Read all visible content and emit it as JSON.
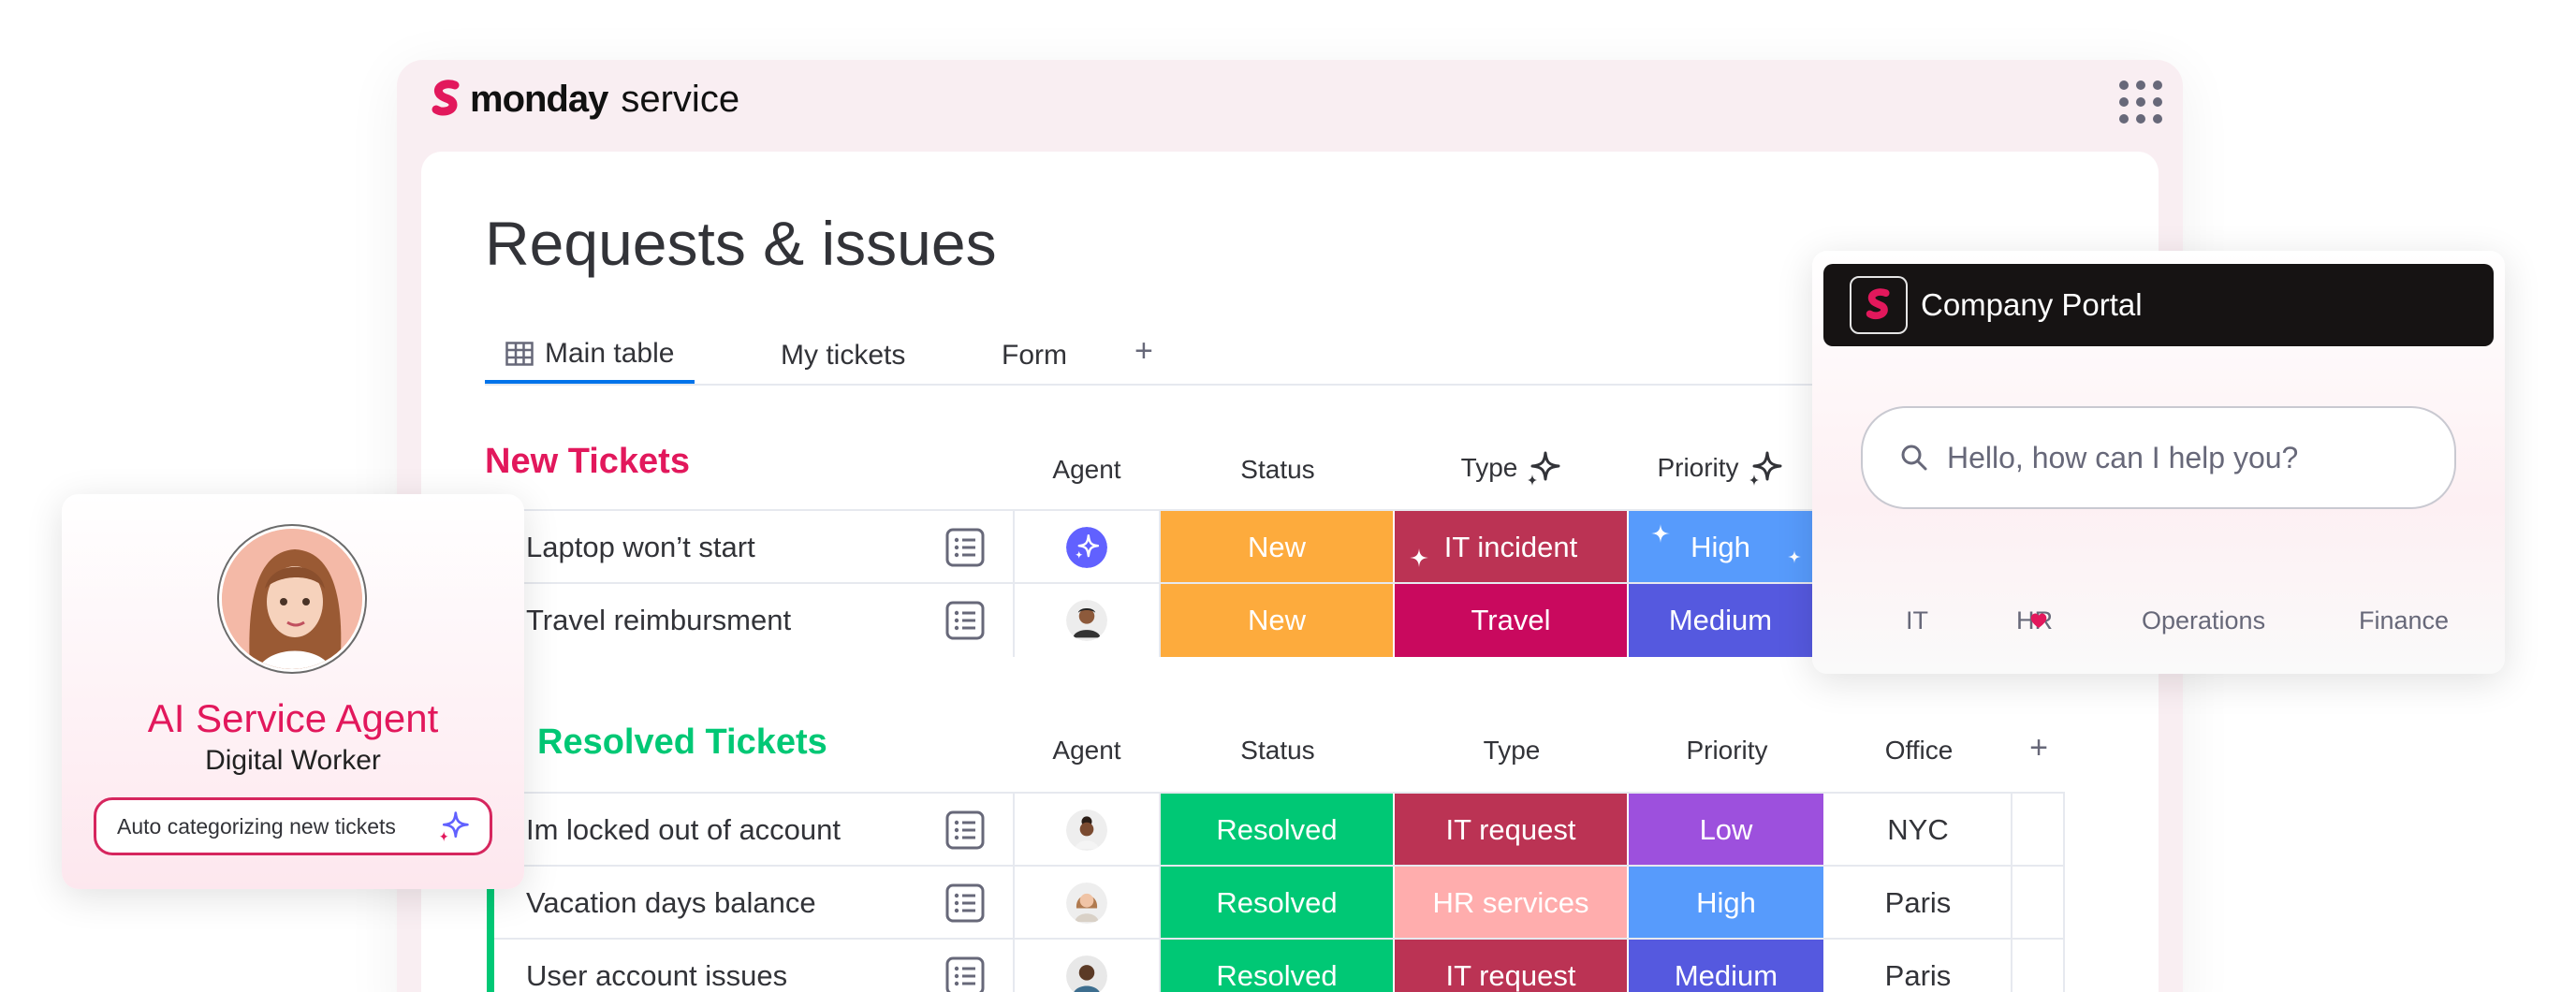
{
  "header": {
    "brand": "monday",
    "product": "service"
  },
  "page": {
    "title": "Requests & issues"
  },
  "tabs": {
    "main": "Main table",
    "my": "My tickets",
    "form": "Form",
    "add": "+"
  },
  "new_group": {
    "title": "New Tickets",
    "color": "#e2185c",
    "columns": {
      "agent": "Agent",
      "status": "Status",
      "type": "Type",
      "priority": "Priority"
    },
    "rows": [
      {
        "name": "Laptop won’t start",
        "status": "New",
        "type": "IT incident",
        "priority": "High"
      },
      {
        "name": "Travel reimbursment",
        "status": "New",
        "type": "Travel",
        "priority": "Medium"
      }
    ]
  },
  "resolved_group": {
    "title": "Resolved Tickets",
    "color": "#00c875",
    "columns": {
      "agent": "Agent",
      "status": "Status",
      "type": "Type",
      "priority": "Priority",
      "office": "Office",
      "add": "+"
    },
    "rows": [
      {
        "name": "Im locked out of account",
        "status": "Resolved",
        "type": "IT request",
        "priority": "Low",
        "office": "NYC"
      },
      {
        "name": "Vacation days balance",
        "status": "Resolved",
        "type": "HR services",
        "priority": "High",
        "office": "Paris"
      },
      {
        "name": "User account issues",
        "status": "Resolved",
        "type": "IT request",
        "priority": "Medium",
        "office": "Paris"
      }
    ]
  },
  "agent_card": {
    "title": "AI Service Agent",
    "subtitle": "Digital Worker",
    "task": "Auto categorizing new tickets"
  },
  "portal": {
    "name": "Company Portal",
    "search_placeholder": "Hello, how can I help you?",
    "categories": [
      "IT",
      "HR",
      "Operations",
      "Finance"
    ]
  },
  "colors": {
    "status_new": "#fdab3d",
    "status_resolved": "#00c875",
    "type_it_incident": "#bb3354",
    "type_travel": "#c9095e",
    "type_it_request": "#bb3354",
    "type_hr_services": "#ffadad",
    "priority_high": "#579bfc",
    "priority_medium": "#5559df",
    "priority_low": "#9d50dd",
    "ai_purple": "#6161ff"
  }
}
